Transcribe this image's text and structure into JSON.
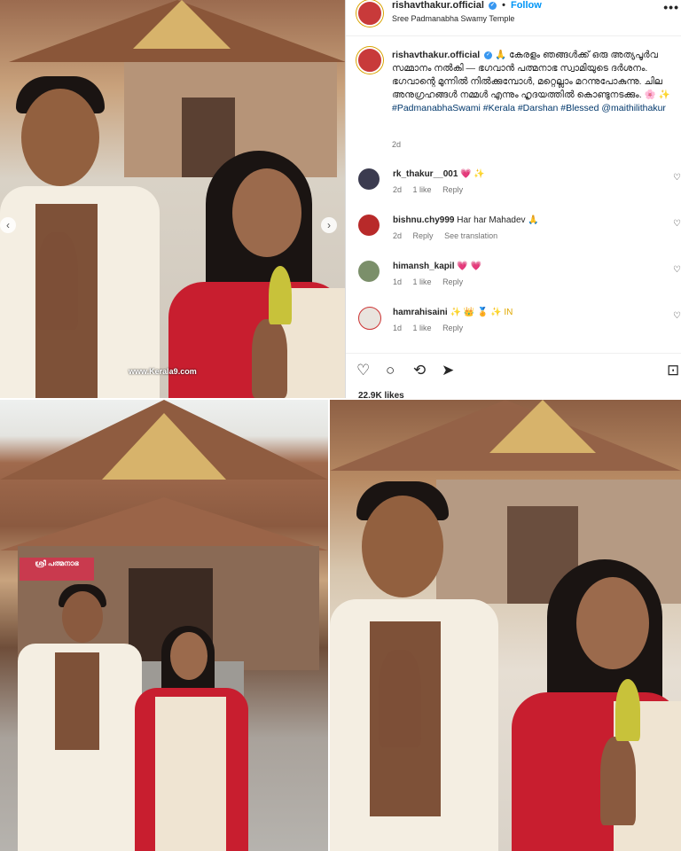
{
  "post": {
    "username": "rishavthakur.official",
    "verified_mark": "✓",
    "separator": "•",
    "follow_label": "Follow",
    "location": "Sree Padmanabha Swamy Temple",
    "more_label": "•••",
    "caption_username": "rishavthakur.official",
    "caption_text": "🙏 കേരളം ഞങ്ങൾക്ക് ഒരു അത്യപൂർവ സമ്മാനം നൽകി — ഭഗവാൻ പത്മനാഭ സ്വാമിയുടെ ദർശനം. ഭഗവാന്റെ മുന്നിൽ നിൽക്കുമ്പോൾ, മറ്റെല്ലാം മറന്നുപോകുന്നു. ചില അനുഗ്രഹങ്ങൾ നമ്മൾ എന്നും ഹൃദയത്തിൽ കൊണ്ടുനടക്കും. 🌸 ✨",
    "hashtags": "#PadmanabhaSwami #Kerala #Darshan #Blessed @maithilithakur",
    "caption_time": "2d",
    "likes": "22.9K likes"
  },
  "comments": [
    {
      "username": "rk_thakur__001",
      "text": "💗 ✨",
      "time": "2d",
      "likes": "1 like",
      "reply": "Reply",
      "see_translation": ""
    },
    {
      "username": "bishnu.chy999",
      "text": "Har har Mahadev 🙏",
      "time": "2d",
      "likes": "",
      "reply": "Reply",
      "see_translation": "See translation"
    },
    {
      "username": "himansh_kapil",
      "text": "💗 💗",
      "time": "1d",
      "likes": "1 like",
      "reply": "Reply",
      "see_translation": ""
    },
    {
      "username": "hamrahisaini",
      "text": "✨ 👑 🏅 ✨ IN",
      "time": "1d",
      "likes": "1 like",
      "reply": "Reply",
      "see_translation": ""
    }
  ],
  "icons": {
    "like": "♡",
    "comment": "○",
    "repost": "⟲",
    "share": "➤",
    "save": "⊡",
    "comment_like": "♡",
    "prev": "‹",
    "next": "›"
  },
  "photos": {
    "watermark": "www.Kerala9.com",
    "temple_sign": "ശ്രീ പത്മനാഭ"
  },
  "colors": {
    "follow": "#0095f6",
    "verified": "#3897f0",
    "hashtag": "#00376b",
    "saree_red": "#c81e2f"
  }
}
